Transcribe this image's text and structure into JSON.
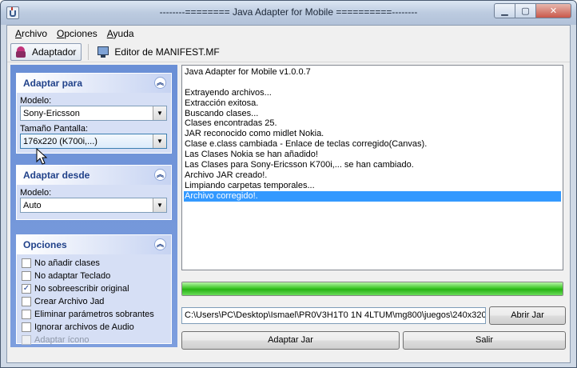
{
  "window": {
    "title": "--------======== Java Adapter for Mobile ==========--------",
    "controls": [
      "minimize",
      "maximize",
      "close"
    ]
  },
  "menu": [
    {
      "label": "Archivo",
      "accel": "A",
      "rest": "rchivo"
    },
    {
      "label": "Opciones",
      "accel": "O",
      "rest": "pciones"
    },
    {
      "label": "Ayuda",
      "accel": "A",
      "rest": "yuda"
    }
  ],
  "toolbar": {
    "adaptar": "Adaptador",
    "editor": "Editor de MANIFEST.MF"
  },
  "adaptar_para": {
    "title": "Adaptar para",
    "modelo_label": "Modelo:",
    "modelo_value": "Sony-Ericsson",
    "tamano_label": "Tamaño Pantalla:",
    "tamano_value": "176x220 (K700i,...)"
  },
  "adaptar_desde": {
    "title": "Adaptar desde",
    "modelo_label": "Modelo:",
    "modelo_value": "Auto"
  },
  "opciones": {
    "title": "Opciones",
    "items": [
      {
        "label": "No añadir clases",
        "checked": false,
        "disabled": false
      },
      {
        "label": "No adaptar Teclado",
        "checked": false,
        "disabled": false
      },
      {
        "label": "No sobreescribir original",
        "checked": true,
        "disabled": false
      },
      {
        "label": "Crear Archivo Jad",
        "checked": false,
        "disabled": false
      },
      {
        "label": "Eliminar parámetros sobrantes",
        "checked": false,
        "disabled": false
      },
      {
        "label": "Ignorar archivos de Audio",
        "checked": false,
        "disabled": false
      },
      {
        "label": "Adaptar ícono",
        "checked": false,
        "disabled": true
      }
    ]
  },
  "log": [
    "Java Adapter for Mobile v1.0.0.7",
    "",
    "Extrayendo archivos...",
    "Extracción exitosa.",
    "Buscando clases...",
    "Clases encontradas 25.",
    "JAR reconocido como midlet Nokia.",
    "Clase e.class cambiada - Enlace de teclas corregido(Canvas).",
    "Las Clases Nokia se han añadido!",
    "Las Clases para Sony-Ericsson K700i,... se han cambiado.",
    "Archivo JAR creado!.",
    "Limpiando carpetas temporales...",
    "Archivo corregido!."
  ],
  "log_selected_index": 12,
  "progress_fraction": 1.0,
  "path_value": "C:\\Users\\PC\\Desktop\\Ismael\\PR0V3H1T0 1N 4LTUM\\mg800\\juegos\\240x320\\",
  "buttons": {
    "abrir": "Abrir Jar",
    "adaptar": "Adaptar Jar",
    "salir": "Salir"
  }
}
